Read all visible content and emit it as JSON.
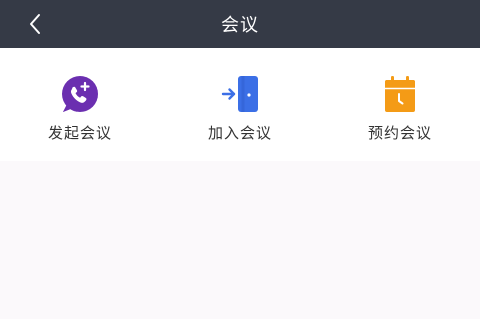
{
  "header": {
    "title": "会议"
  },
  "actions": [
    {
      "label": "发起会议",
      "icon": "phone-plus-icon",
      "color": "#6b2fb0"
    },
    {
      "label": "加入会议",
      "icon": "door-enter-icon",
      "color": "#3b6fe6"
    },
    {
      "label": "预约会议",
      "icon": "calendar-icon",
      "color": "#f49b16"
    }
  ],
  "colors": {
    "navbar": "#353a46",
    "page_bg": "#fbf9fb"
  }
}
